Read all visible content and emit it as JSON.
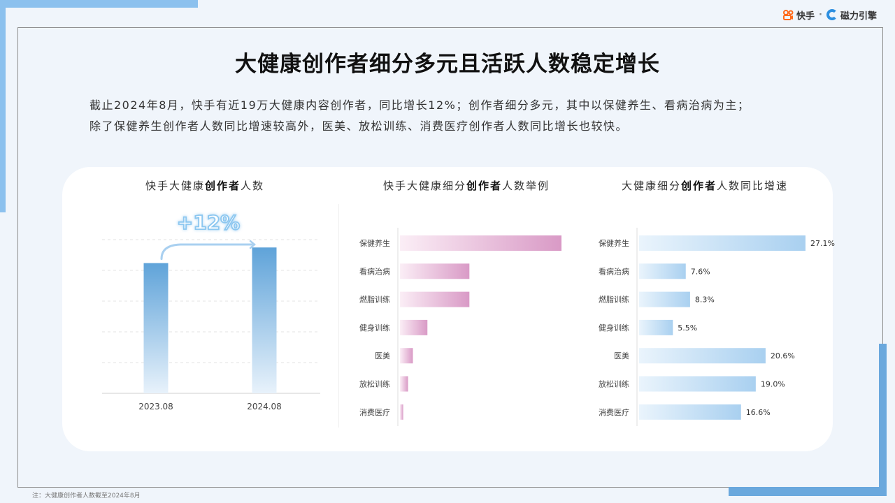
{
  "brand": {
    "name1": "快手",
    "separator": "·",
    "name2": "磁力引擎"
  },
  "title": "大健康创作者细分多元且活跃人数稳定增长",
  "description": [
    "截止2024年8月，快手有近19万大健康内容创作者，同比增长12%；创作者细分多元，其中以保健养生、看病治病为主；",
    "除了保健养生创作者人数同比增速较高外，医美、放松训练、消费医疗创作者人数同比增长也较快。"
  ],
  "panels": [
    {
      "pre": "快手大健康",
      "bold": "创作者",
      "post": "人数"
    },
    {
      "pre": "快手大健康细分",
      "bold": "创作者",
      "post": "人数举例"
    },
    {
      "pre": "大健康细分",
      "bold": "创作者",
      "post": "人数同比增速"
    }
  ],
  "footnote": "注：大健康创作者人数截至2024年8月",
  "colors": {
    "blue": "#5fa3d9",
    "pink": "#d99ac6",
    "lightblue": "#a9d0f0"
  },
  "chart_data": [
    {
      "type": "bar",
      "categories": [
        "2023.08",
        "2024.08"
      ],
      "values": [
        100,
        112
      ],
      "annotation": "+12%",
      "ylim": [
        0,
        125
      ],
      "grid": true
    },
    {
      "type": "bar",
      "orientation": "horizontal",
      "categories": [
        "保健养生",
        "看病治病",
        "燃脂训练",
        "健身训练",
        "医美",
        "放松训练",
        "消费医疗"
      ],
      "values": [
        100,
        43,
        43,
        17,
        8,
        5,
        2
      ],
      "xlim": [
        0,
        100
      ]
    },
    {
      "type": "bar",
      "orientation": "horizontal",
      "categories": [
        "保健养生",
        "看病治病",
        "燃脂训练",
        "健身训练",
        "医美",
        "放松训练",
        "消费医疗"
      ],
      "values": [
        27.1,
        7.6,
        8.3,
        5.5,
        20.6,
        19.0,
        16.6
      ],
      "data_labels": [
        "27.1%",
        "7.6%",
        "8.3%",
        "5.5%",
        "20.6%",
        "19.0%",
        "16.6%"
      ],
      "xlim": [
        0,
        27.1
      ]
    }
  ]
}
